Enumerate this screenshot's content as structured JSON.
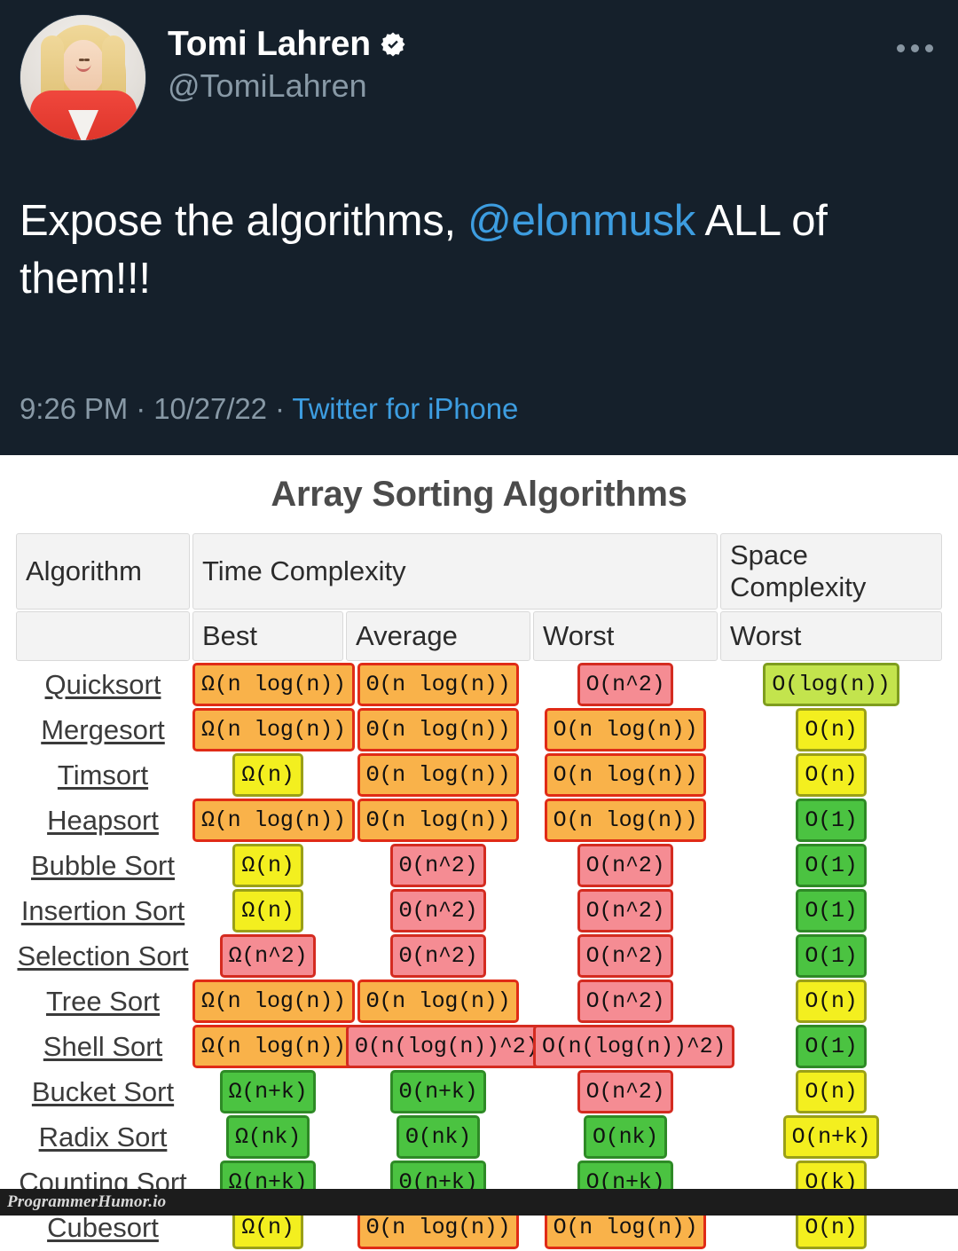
{
  "tweet": {
    "display_name": "Tomi Lahren",
    "handle": "@TomiLahren",
    "verified_icon": "verified-badge-icon",
    "more_icon": "more-options-icon",
    "avatar_icon": "avatar-photo",
    "text_before": "Expose the algorithms, ",
    "mention": "@elonmusk",
    "text_after": " ALL of them!!!",
    "time": "9:26 PM",
    "separator1": " · ",
    "date": "10/27/22",
    "separator2": " · ",
    "source": "Twitter for iPhone",
    "background_color": "#15202B",
    "link_color": "#3D9DE0",
    "muted_color": "#8899A6"
  },
  "table": {
    "title": "Array Sorting Algorithms",
    "header_row1": [
      "Algorithm",
      "Time Complexity",
      "Space Complexity"
    ],
    "header_row2": [
      "",
      "Best",
      "Average",
      "Worst",
      "Worst"
    ],
    "colors": {
      "orange": "#F9B24A",
      "red": "#F58C93",
      "yellow": "#F3EF1F",
      "light_green": "#C3E44D",
      "green": "#4BC341"
    },
    "rows": [
      {
        "algorithm": "Quicksort",
        "best": {
          "text": "Ω(n log(n))",
          "color": "orange"
        },
        "average": {
          "text": "Θ(n log(n))",
          "color": "orange"
        },
        "worst": {
          "text": "O(n^2)",
          "color": "red"
        },
        "space": {
          "text": "O(log(n))",
          "color": "light_green"
        }
      },
      {
        "algorithm": "Mergesort",
        "best": {
          "text": "Ω(n log(n))",
          "color": "orange"
        },
        "average": {
          "text": "Θ(n log(n))",
          "color": "orange"
        },
        "worst": {
          "text": "O(n log(n))",
          "color": "orange"
        },
        "space": {
          "text": "O(n)",
          "color": "yellow"
        }
      },
      {
        "algorithm": "Timsort",
        "best": {
          "text": "Ω(n)",
          "color": "yellow"
        },
        "average": {
          "text": "Θ(n log(n))",
          "color": "orange"
        },
        "worst": {
          "text": "O(n log(n))",
          "color": "orange"
        },
        "space": {
          "text": "O(n)",
          "color": "yellow"
        }
      },
      {
        "algorithm": "Heapsort",
        "best": {
          "text": "Ω(n log(n))",
          "color": "orange"
        },
        "average": {
          "text": "Θ(n log(n))",
          "color": "orange"
        },
        "worst": {
          "text": "O(n log(n))",
          "color": "orange"
        },
        "space": {
          "text": "O(1)",
          "color": "green"
        }
      },
      {
        "algorithm": "Bubble Sort",
        "best": {
          "text": "Ω(n)",
          "color": "yellow"
        },
        "average": {
          "text": "Θ(n^2)",
          "color": "red"
        },
        "worst": {
          "text": "O(n^2)",
          "color": "red"
        },
        "space": {
          "text": "O(1)",
          "color": "green"
        }
      },
      {
        "algorithm": "Insertion Sort",
        "best": {
          "text": "Ω(n)",
          "color": "yellow"
        },
        "average": {
          "text": "Θ(n^2)",
          "color": "red"
        },
        "worst": {
          "text": "O(n^2)",
          "color": "red"
        },
        "space": {
          "text": "O(1)",
          "color": "green"
        }
      },
      {
        "algorithm": "Selection Sort",
        "best": {
          "text": "Ω(n^2)",
          "color": "red"
        },
        "average": {
          "text": "Θ(n^2)",
          "color": "red"
        },
        "worst": {
          "text": "O(n^2)",
          "color": "red"
        },
        "space": {
          "text": "O(1)",
          "color": "green"
        }
      },
      {
        "algorithm": "Tree Sort",
        "best": {
          "text": "Ω(n log(n))",
          "color": "orange"
        },
        "average": {
          "text": "Θ(n log(n))",
          "color": "orange"
        },
        "worst": {
          "text": "O(n^2)",
          "color": "red"
        },
        "space": {
          "text": "O(n)",
          "color": "yellow"
        }
      },
      {
        "algorithm": "Shell Sort",
        "best": {
          "text": "Ω(n log(n))",
          "color": "orange"
        },
        "average": {
          "text": "Θ(n(log(n))^2)",
          "color": "red"
        },
        "worst": {
          "text": "O(n(log(n))^2)",
          "color": "red"
        },
        "space": {
          "text": "O(1)",
          "color": "green"
        }
      },
      {
        "algorithm": "Bucket Sort",
        "best": {
          "text": "Ω(n+k)",
          "color": "green"
        },
        "average": {
          "text": "Θ(n+k)",
          "color": "green"
        },
        "worst": {
          "text": "O(n^2)",
          "color": "red"
        },
        "space": {
          "text": "O(n)",
          "color": "yellow"
        }
      },
      {
        "algorithm": "Radix Sort",
        "best": {
          "text": "Ω(nk)",
          "color": "green"
        },
        "average": {
          "text": "Θ(nk)",
          "color": "green"
        },
        "worst": {
          "text": "O(nk)",
          "color": "green"
        },
        "space": {
          "text": "O(n+k)",
          "color": "yellow"
        }
      },
      {
        "algorithm": "Counting Sort",
        "best": {
          "text": "Ω(n+k)",
          "color": "green"
        },
        "average": {
          "text": "Θ(n+k)",
          "color": "green"
        },
        "worst": {
          "text": "O(n+k)",
          "color": "green"
        },
        "space": {
          "text": "O(k)",
          "color": "yellow"
        }
      },
      {
        "algorithm": "Cubesort",
        "best": {
          "text": "Ω(n)",
          "color": "yellow"
        },
        "average": {
          "text": "Θ(n log(n))",
          "color": "orange"
        },
        "worst": {
          "text": "O(n log(n))",
          "color": "orange"
        },
        "space": {
          "text": "O(n)",
          "color": "yellow"
        }
      }
    ]
  },
  "footer": {
    "watermark": "ProgrammerHumor.io"
  }
}
